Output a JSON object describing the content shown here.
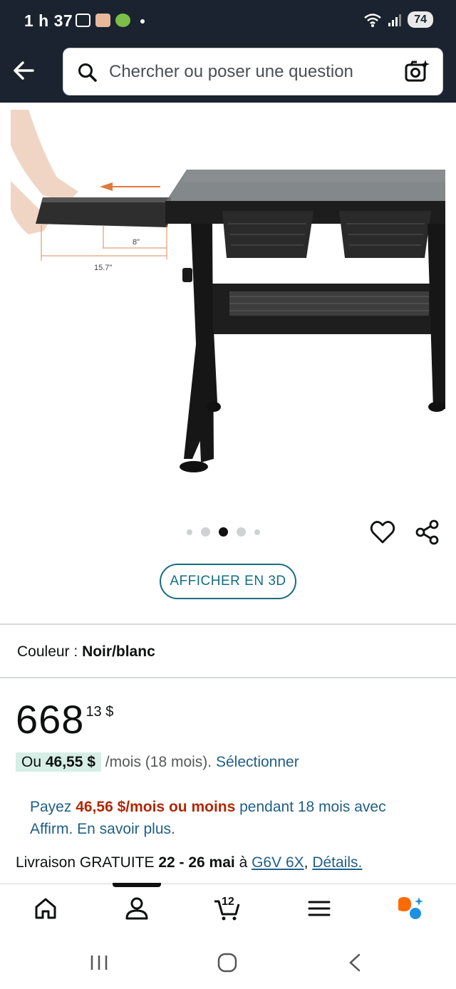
{
  "status_bar": {
    "time": "1 h 37",
    "battery": "74"
  },
  "search": {
    "placeholder": "Chercher ou poser une question"
  },
  "product_image": {
    "dimension_short": "8\"",
    "dimension_long": "15.7\""
  },
  "carousel": {
    "count": 5,
    "active_index": 2
  },
  "view_3d_label": "AFFICHER EN 3D",
  "color": {
    "label": "Couleur :",
    "value": "Noir/blanc"
  },
  "price": {
    "whole": "668",
    "cents": "13 $"
  },
  "monthly": {
    "prefix": "Ou ",
    "amount": "46,55 $",
    "term": " /mois (18 mois). ",
    "select_link": "Sélectionner"
  },
  "affirm": {
    "part1": "Payez ",
    "amount": "46,56 $/mois ou moins",
    "part2": " pendant 18 mois avec Affirm. ",
    "link": "En savoir plus."
  },
  "delivery": {
    "prefix": "Livraison GRATUITE ",
    "dates": "22 - 26 mai",
    "middle": " à  ",
    "postal": "G6V 6X",
    "details": "Détails."
  },
  "bottom_nav": {
    "cart_count": "12",
    "items": [
      "home-icon",
      "account-icon",
      "cart-icon",
      "menu-icon",
      "rufus-ai-icon"
    ]
  },
  "colors": {
    "header_bg": "#1a232f",
    "link": "#1f5f86",
    "price_red": "#b12704",
    "teal": "#136e7f"
  }
}
